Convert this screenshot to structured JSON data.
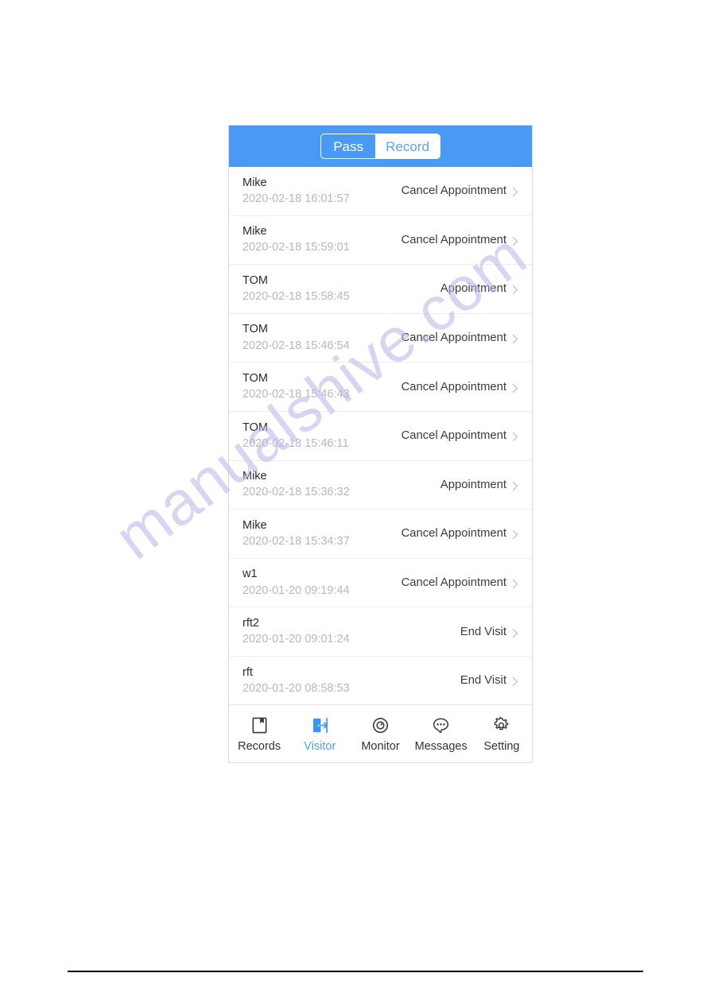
{
  "watermark": {
    "text": "manualshive.com"
  },
  "colors": {
    "header_blue": "#4a9af5",
    "accent_blue": "#52a0f2",
    "row_name": "#2b2b2b",
    "row_time": "#b6b8bd",
    "separator": "#ededf0"
  },
  "header": {
    "segmented": {
      "selected": "Record",
      "options": [
        {
          "label": "Pass",
          "selected": false
        },
        {
          "label": "Record",
          "selected": true
        }
      ]
    }
  },
  "list": {
    "rows": [
      {
        "name": "Mike",
        "time": "2020-02-18 16:01:57",
        "action": "Cancel Appointment"
      },
      {
        "name": "Mike",
        "time": "2020-02-18 15:59:01",
        "action": "Cancel Appointment"
      },
      {
        "name": "TOM",
        "time": "2020-02-18 15:58:45",
        "action": "Appointment"
      },
      {
        "name": "TOM",
        "time": "2020-02-18 15:46:54",
        "action": "Cancel Appointment"
      },
      {
        "name": "TOM",
        "time": "2020-02-18 15:46:43",
        "action": "Cancel Appointment"
      },
      {
        "name": "TOM",
        "time": "2020-02-18 15:46:11",
        "action": "Cancel Appointment"
      },
      {
        "name": "Mike",
        "time": "2020-02-18 15:36:32",
        "action": "Appointment"
      },
      {
        "name": "Mike",
        "time": "2020-02-18 15:34:37",
        "action": "Cancel Appointment"
      },
      {
        "name": "w1",
        "time": "2020-01-20 09:19:44",
        "action": "Cancel Appointment"
      },
      {
        "name": "rft2",
        "time": "2020-01-20 09:01:24",
        "action": "End Visit"
      },
      {
        "name": "rft",
        "time": "2020-01-20 08:58:53",
        "action": "End Visit"
      }
    ]
  },
  "tabbar": {
    "active": "Visitor",
    "items": [
      {
        "label": "Records",
        "icon": "book-icon",
        "active": false
      },
      {
        "label": "Visitor",
        "icon": "door-exit-icon",
        "active": true
      },
      {
        "label": "Monitor",
        "icon": "camera-target-icon",
        "active": false
      },
      {
        "label": "Messages",
        "icon": "chat-bubble-icon",
        "active": false
      },
      {
        "label": "Setting",
        "icon": "gear-icon",
        "active": false
      }
    ]
  }
}
